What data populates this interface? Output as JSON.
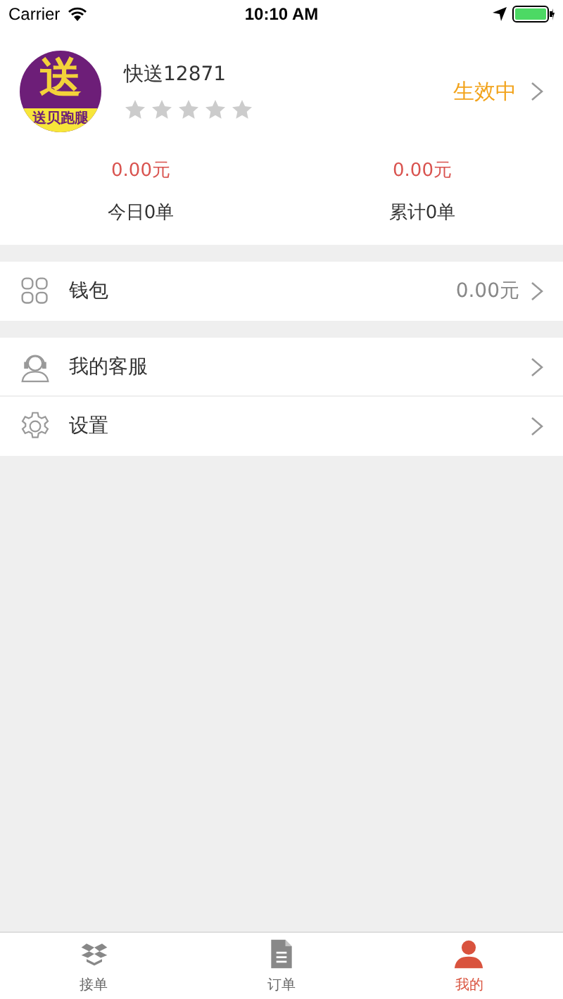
{
  "status_bar": {
    "carrier": "Carrier",
    "time": "10:10 AM"
  },
  "profile": {
    "avatar": {
      "glyph": "送",
      "caption": "送贝跑腿"
    },
    "name": "快送12871",
    "stars": 0,
    "status": "生效中"
  },
  "stats": [
    {
      "amount": "0.00元",
      "label": "今日0单"
    },
    {
      "amount": "0.00元",
      "label": "累计0单"
    }
  ],
  "menu_groups": [
    [
      {
        "kind": "wallet",
        "label": "钱包",
        "value": "0.00元"
      }
    ],
    [
      {
        "kind": "service",
        "label": "我的客服"
      },
      {
        "kind": "settings",
        "label": "设置"
      }
    ]
  ],
  "tab_bar": [
    {
      "kind": "orders-hall",
      "label": "接单",
      "selected": false
    },
    {
      "kind": "orders",
      "label": "订单",
      "selected": false
    },
    {
      "kind": "me",
      "label": "我的",
      "selected": true
    }
  ]
}
